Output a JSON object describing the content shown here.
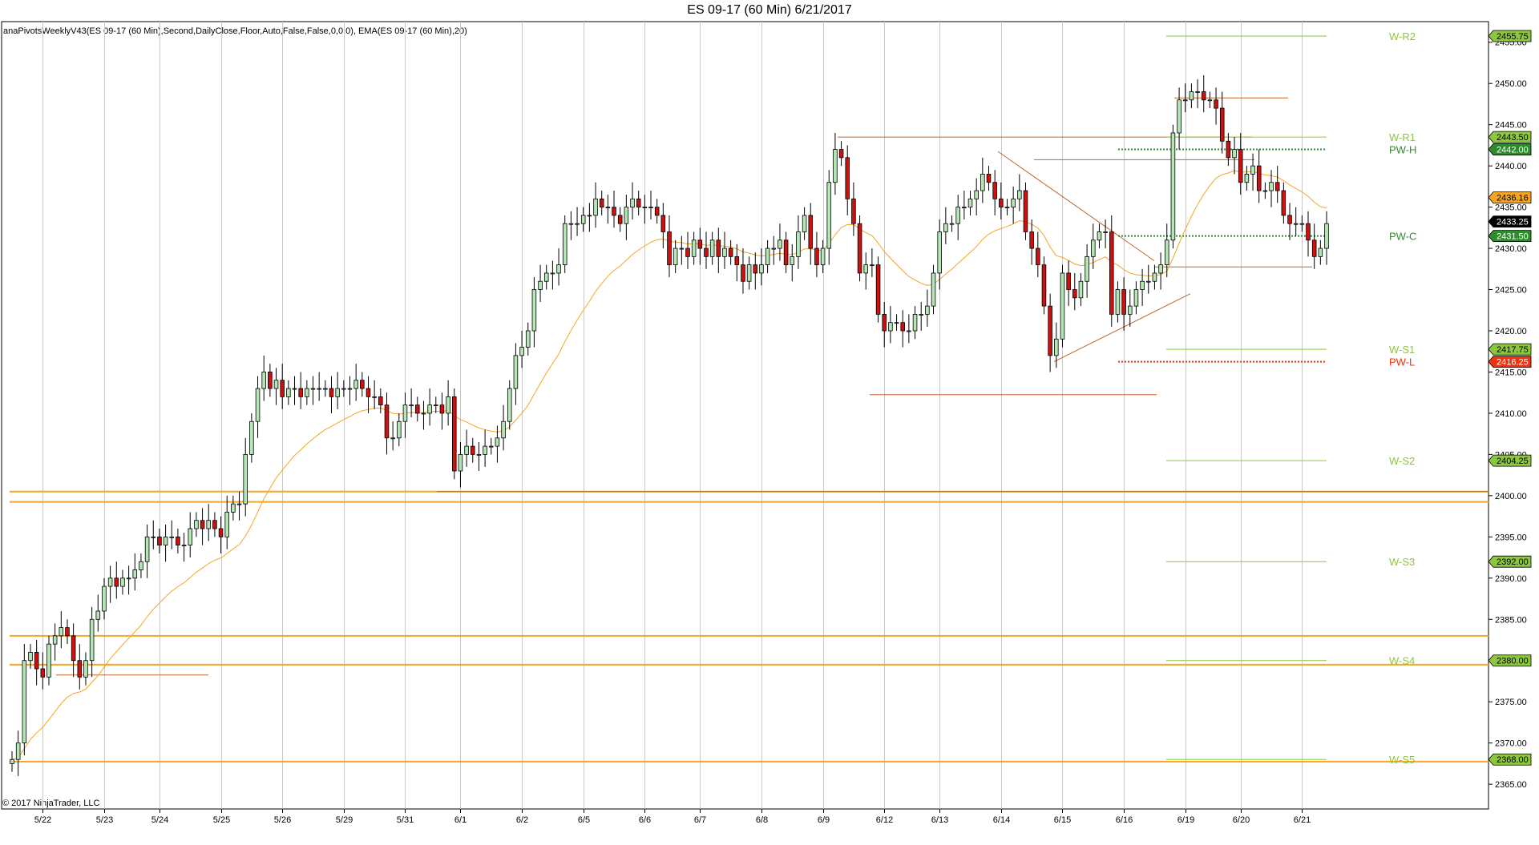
{
  "chart_data": {
    "type": "candlestick",
    "title": "ES 09-17 (60 Min)  6/21/2017",
    "indicator_label": "anaPivotsWeeklyV43(ES 09-17 (60 Min),Second,DailyClose,Floor,Auto,False,False,0,0,0), EMA(ES 09-17 (60 Min),20)",
    "copyright": "© 2017 NinjaTrader, LLC",
    "ylim": [
      2362.0,
      2457.5
    ],
    "y_ticks": [
      2365,
      2370,
      2375,
      2380,
      2385,
      2390,
      2395,
      2400,
      2405,
      2410,
      2415,
      2420,
      2425,
      2430,
      2435,
      2440,
      2445,
      2450,
      2455
    ],
    "y_tick_labels": [
      "2365.00",
      "2370.00",
      "2375.00",
      "2380.00",
      "2385.00",
      "2390.00",
      "2395.00",
      "2400.00",
      "2405.00",
      "2410.00",
      "2415.00",
      "2420.00",
      "2425.00",
      "2430.00",
      "2435.00",
      "2440.00",
      "2445.00",
      "2450.00",
      "2455.00"
    ],
    "x_sessions": [
      "5/22",
      "5/23",
      "5/24",
      "5/25",
      "5/26",
      "5/29",
      "5/31",
      "6/1",
      "6/2",
      "6/5",
      "6/6",
      "6/7",
      "6/8",
      "6/9",
      "6/12",
      "6/13",
      "6/14",
      "6/15",
      "6/16",
      "6/19",
      "6/20",
      "6/21"
    ],
    "colors": {
      "up": "#b5e6b5",
      "down": "#cc1111",
      "ema": "#f5a623",
      "support_line": "#f5a623",
      "pivot_green": "#8dc63f",
      "pw_h": "#2e8b2e",
      "pw_l": "#ee3311",
      "trendline": "#c0642a"
    },
    "candles_close": [
      2368,
      2370,
      2380,
      2381,
      2379,
      2378,
      2382,
      2383,
      2384,
      2383,
      2380,
      2378,
      2380,
      2385,
      2386,
      2389,
      2390,
      2389,
      2390,
      2390,
      2391,
      2392,
      2395,
      2395,
      2394,
      2395,
      2395,
      2394,
      2394,
      2396,
      2397,
      2396,
      2397,
      2396,
      2395,
      2398,
      2399,
      2399,
      2405,
      2409,
      2413,
      2415,
      2413,
      2414,
      2412,
      2413,
      2413,
      2412,
      2413,
      2413,
      2413,
      2413,
      2412,
      2413,
      2413,
      2413,
      2414,
      2413,
      2412,
      2412,
      2411,
      2407,
      2407,
      2409,
      2411,
      2411,
      2410,
      2410,
      2411,
      2411,
      2410,
      2412,
      2403,
      2405,
      2406,
      2405,
      2405,
      2406,
      2406,
      2407,
      2409,
      2413,
      2417,
      2418,
      2420,
      2425,
      2426,
      2427,
      2427,
      2428,
      2433,
      2433,
      2433,
      2434,
      2434,
      2436,
      2435,
      2435,
      2434,
      2433,
      2435,
      2436,
      2435,
      2435,
      2435,
      2434,
      2432,
      2428,
      2430,
      2430,
      2429,
      2431,
      2430,
      2429,
      2431,
      2429,
      2430,
      2429,
      2428,
      2426,
      2428,
      2427,
      2428,
      2430,
      2430,
      2431,
      2428,
      2429,
      2432,
      2434,
      2430,
      2428,
      2430,
      2438,
      2442,
      2441,
      2436,
      2433,
      2427,
      2428,
      2428,
      2422,
      2420,
      2421,
      2421,
      2420,
      2420,
      2422,
      2422,
      2423,
      2427,
      2432,
      2433,
      2433,
      2435,
      2435,
      2436,
      2437,
      2439,
      2438,
      2436,
      2435,
      2435,
      2436,
      2437,
      2432,
      2430,
      2428,
      2423,
      2417,
      2419,
      2427,
      2425,
      2424,
      2426,
      2429,
      2431,
      2432,
      2432,
      2422,
      2425,
      2422,
      2423,
      2425,
      2426,
      2426,
      2427,
      2428,
      2431,
      2444,
      2448,
      2448,
      2449,
      2449,
      2448,
      2448,
      2447,
      2443,
      2441,
      2442,
      2438,
      2439,
      2440,
      2437,
      2437,
      2438,
      2437,
      2434,
      2433,
      2433,
      2433,
      2431,
      2429,
      2430,
      2433
    ],
    "pivot_levels": [
      {
        "label": "W-R2",
        "value": 2455.75,
        "tag": "2455.75",
        "style": "solid",
        "color": "#8dc63f"
      },
      {
        "label": "W-R1",
        "value": 2443.5,
        "tag": "2443.50",
        "style": "solid",
        "color": "#8dc63f"
      },
      {
        "label": "PW-H",
        "value": 2442.0,
        "tag": "2442.00",
        "style": "dotted",
        "color": "#2e8b2e"
      },
      {
        "label": "PW-C",
        "value": 2431.5,
        "tag": "2431.50",
        "style": "dotted",
        "color": "#2e8b2e"
      },
      {
        "label": "W-S1",
        "value": 2417.75,
        "tag": "2417.75",
        "style": "solid",
        "color": "#8dc63f"
      },
      {
        "label": "PW-L",
        "value": 2416.25,
        "tag": "2416.25",
        "style": "dotted",
        "color": "#ee3311"
      },
      {
        "label": "W-S2",
        "value": 2404.25,
        "tag": "2404.25",
        "style": "solid",
        "color": "#8dc63f"
      },
      {
        "label": "W-S3",
        "value": 2392.0,
        "tag": "2392.00",
        "style": "solid",
        "color": "#8dc63f"
      },
      {
        "label": "W-S4",
        "value": 2380.0,
        "tag": "2380.00",
        "style": "solid",
        "color": "#8dc63f"
      },
      {
        "label": "W-S5",
        "value": 2368.0,
        "tag": "2368.00",
        "style": "solid",
        "color": "#8dc63f"
      }
    ],
    "extra_price_tags": [
      {
        "value": 2436.16,
        "tag": "2436.16",
        "color": "#f5a623"
      },
      {
        "value": 2433.25,
        "tag": "2433.25",
        "color": "#000000"
      }
    ],
    "support_levels": [
      2400.5,
      2399.25,
      2383.0,
      2379.5,
      2367.75
    ]
  }
}
